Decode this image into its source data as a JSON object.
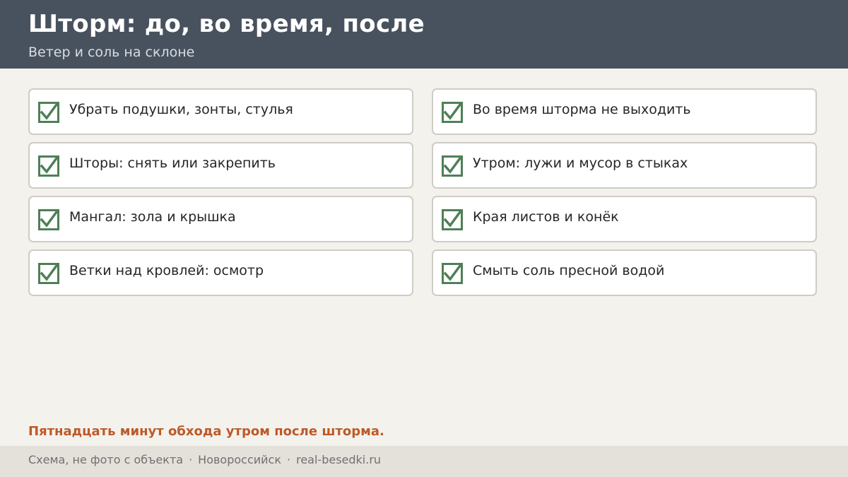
{
  "header": {
    "title": "Шторм: до, во время, после",
    "subtitle": "Ветер и соль на склоне"
  },
  "checklist": {
    "left": [
      {
        "label": "Убрать подушки, зонты, стулья",
        "checked": true
      },
      {
        "label": "Шторы: снять или закрепить",
        "checked": true
      },
      {
        "label": "Мангал: зола и крышка",
        "checked": true
      },
      {
        "label": "Ветки над кровлей: осмотр",
        "checked": true
      }
    ],
    "right": [
      {
        "label": "Во время шторма не выходить",
        "checked": true
      },
      {
        "label": "Утром: лужи и мусор в стыках",
        "checked": true
      },
      {
        "label": "Края листов и конёк",
        "checked": true
      },
      {
        "label": "Смыть соль пресной водой",
        "checked": true
      }
    ]
  },
  "note": "Пятнадцать минут обхода утром после шторма.",
  "footer": {
    "part1": "Схема, не фото с объекта",
    "separator": "·",
    "part2": "Новороссийск",
    "part3": "real-besedki.ru"
  },
  "colors": {
    "header_bg": "#48525f",
    "check_green": "#4f7f57",
    "note_accent": "#bd5a28",
    "page_bg": "#f4f2ed"
  },
  "icons": {
    "check": "checkbox-checked-icon"
  }
}
